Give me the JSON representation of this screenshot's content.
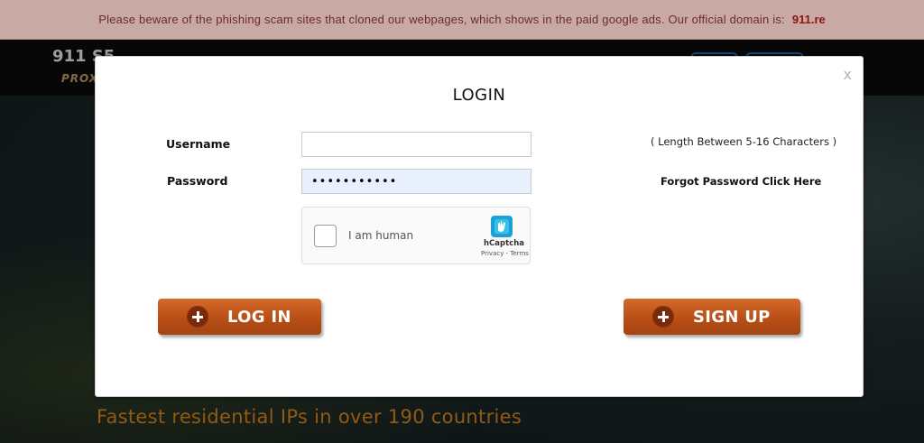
{
  "banner": {
    "text": "Please beware of the phishing scam sites that cloned our webpages, which shows in the paid google ads. Our official domain is:",
    "domain": "911.re"
  },
  "background": {
    "logo": "911.S5",
    "logo_sub": "PROXY",
    "hero_title": "Fastest residential IPs in over 190 countries"
  },
  "modal": {
    "title": "LOGIN",
    "close_label": "x",
    "username_label": "Username",
    "username_value": "",
    "password_label": "Password",
    "password_value": "•••••••••••",
    "length_hint": "( Length Between 5-16 Characters )",
    "forgot_link": "Forgot Password Click Here",
    "captcha": {
      "label": "I am human",
      "brand": "hCaptcha",
      "links": "Privacy - Terms"
    },
    "login_button": "LOG IN",
    "signup_button": "SIGN UP"
  },
  "colors": {
    "banner_bg": "#c9a9a3",
    "banner_text": "#6b2b2b",
    "button_orange": "#c05a1f",
    "hero_title": "#e08a1c"
  },
  "icons": [
    "close-icon",
    "plus-circle-icon",
    "hcaptcha-logo-icon"
  ]
}
